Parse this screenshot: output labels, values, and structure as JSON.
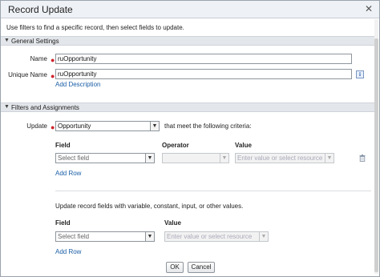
{
  "window": {
    "title": "Record Update"
  },
  "intro": "Use filters to find a specific record, then select fields to update.",
  "general_settings": {
    "header": "General Settings",
    "name_label": "Name",
    "name_value": "ruOpportunity",
    "unique_name_label": "Unique Name",
    "unique_name_value": "ruOpportunity",
    "add_description": "Add Description",
    "info_icon": "i"
  },
  "filters": {
    "header": "Filters and Assignments",
    "update_label": "Update",
    "update_value": "Opportunity",
    "criteria_text": "that meet the following criteria:",
    "columns": {
      "field": "Field",
      "operator": "Operator",
      "value": "Value"
    },
    "row": {
      "field_placeholder": "Select field",
      "operator_value": "",
      "value_placeholder": "Enter value or select resource"
    },
    "add_row": "Add Row"
  },
  "assignments": {
    "intro": "Update record fields with variable, constant, input, or other values.",
    "columns": {
      "field": "Field",
      "value": "Value"
    },
    "row": {
      "field_placeholder": "Select field",
      "value_placeholder": "Enter value or select resource"
    },
    "add_row": "Add Row"
  },
  "footer": {
    "ok": "OK",
    "cancel": "Cancel"
  },
  "icons": {
    "close": "close-icon",
    "section_toggle": "triangle-down-icon",
    "dropdown": "chevron-down-icon",
    "info": "info-icon",
    "delete": "trash-icon"
  },
  "colors": {
    "required": "#d0212b",
    "link": "#1a5ea6",
    "section_bg": "#e3e6ea"
  }
}
